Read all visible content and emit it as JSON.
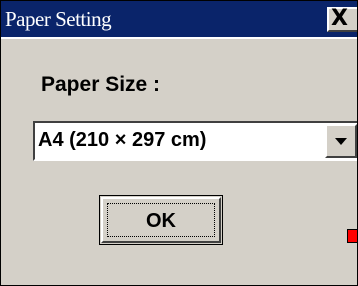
{
  "window": {
    "title": "Paper Setting",
    "close_glyph": "X",
    "close_icon": "close-icon"
  },
  "main": {
    "paper_size_label": "Paper Size :",
    "paper_size_value": "A4 (210 × 297 cm)",
    "dropdown_icon": "chevron-down-icon",
    "ok_label": "OK"
  },
  "colors": {
    "titlebar": "#0a246a",
    "window_face": "#d4d0c8",
    "marker": "#ff0000"
  }
}
